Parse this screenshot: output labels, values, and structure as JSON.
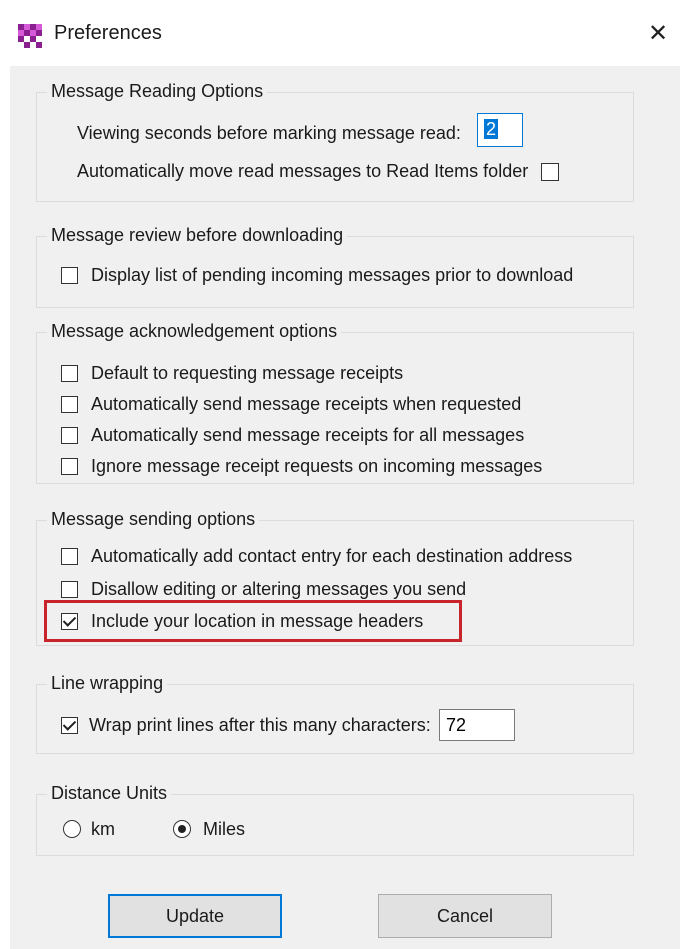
{
  "window": {
    "title": "Preferences",
    "close_glyph": "✕",
    "icon": "checkered-app-icon"
  },
  "groups": {
    "reading": {
      "title": "Message Reading Options",
      "viewing_seconds_label": "Viewing seconds before marking message read:",
      "viewing_seconds_value": "2",
      "auto_move_label": "Automatically move read messages to Read Items folder",
      "auto_move_checked": false
    },
    "review": {
      "title": "Message review before downloading",
      "display_pending_label": "Display list of pending incoming messages prior to download",
      "display_pending_checked": false
    },
    "ack": {
      "title": "Message acknowledgement options",
      "items": [
        {
          "label": "Default to requesting message receipts",
          "checked": false
        },
        {
          "label": "Automatically send message receipts when requested",
          "checked": false
        },
        {
          "label": "Automatically send message receipts for all messages",
          "checked": false
        },
        {
          "label": "Ignore message receipt requests on incoming messages",
          "checked": false
        }
      ]
    },
    "sending": {
      "title": "Message sending options",
      "items": [
        {
          "label": "Automatically add contact entry for each destination address",
          "checked": false
        },
        {
          "label": "Disallow editing or altering messages you send",
          "checked": false
        },
        {
          "label": "Include your location in message headers",
          "checked": true
        }
      ]
    },
    "wrapping": {
      "title": "Line wrapping",
      "wrap_label": "Wrap print lines after this many characters:",
      "wrap_checked": true,
      "wrap_value": "72"
    },
    "distance": {
      "title": "Distance Units",
      "options": [
        {
          "label": "km",
          "selected": false
        },
        {
          "label": "Miles",
          "selected": true
        }
      ]
    }
  },
  "buttons": {
    "update": "Update",
    "cancel": "Cancel"
  },
  "colors": {
    "highlight": "#c8242b",
    "accent": "#0078d7",
    "background": "#f0f0f0"
  }
}
